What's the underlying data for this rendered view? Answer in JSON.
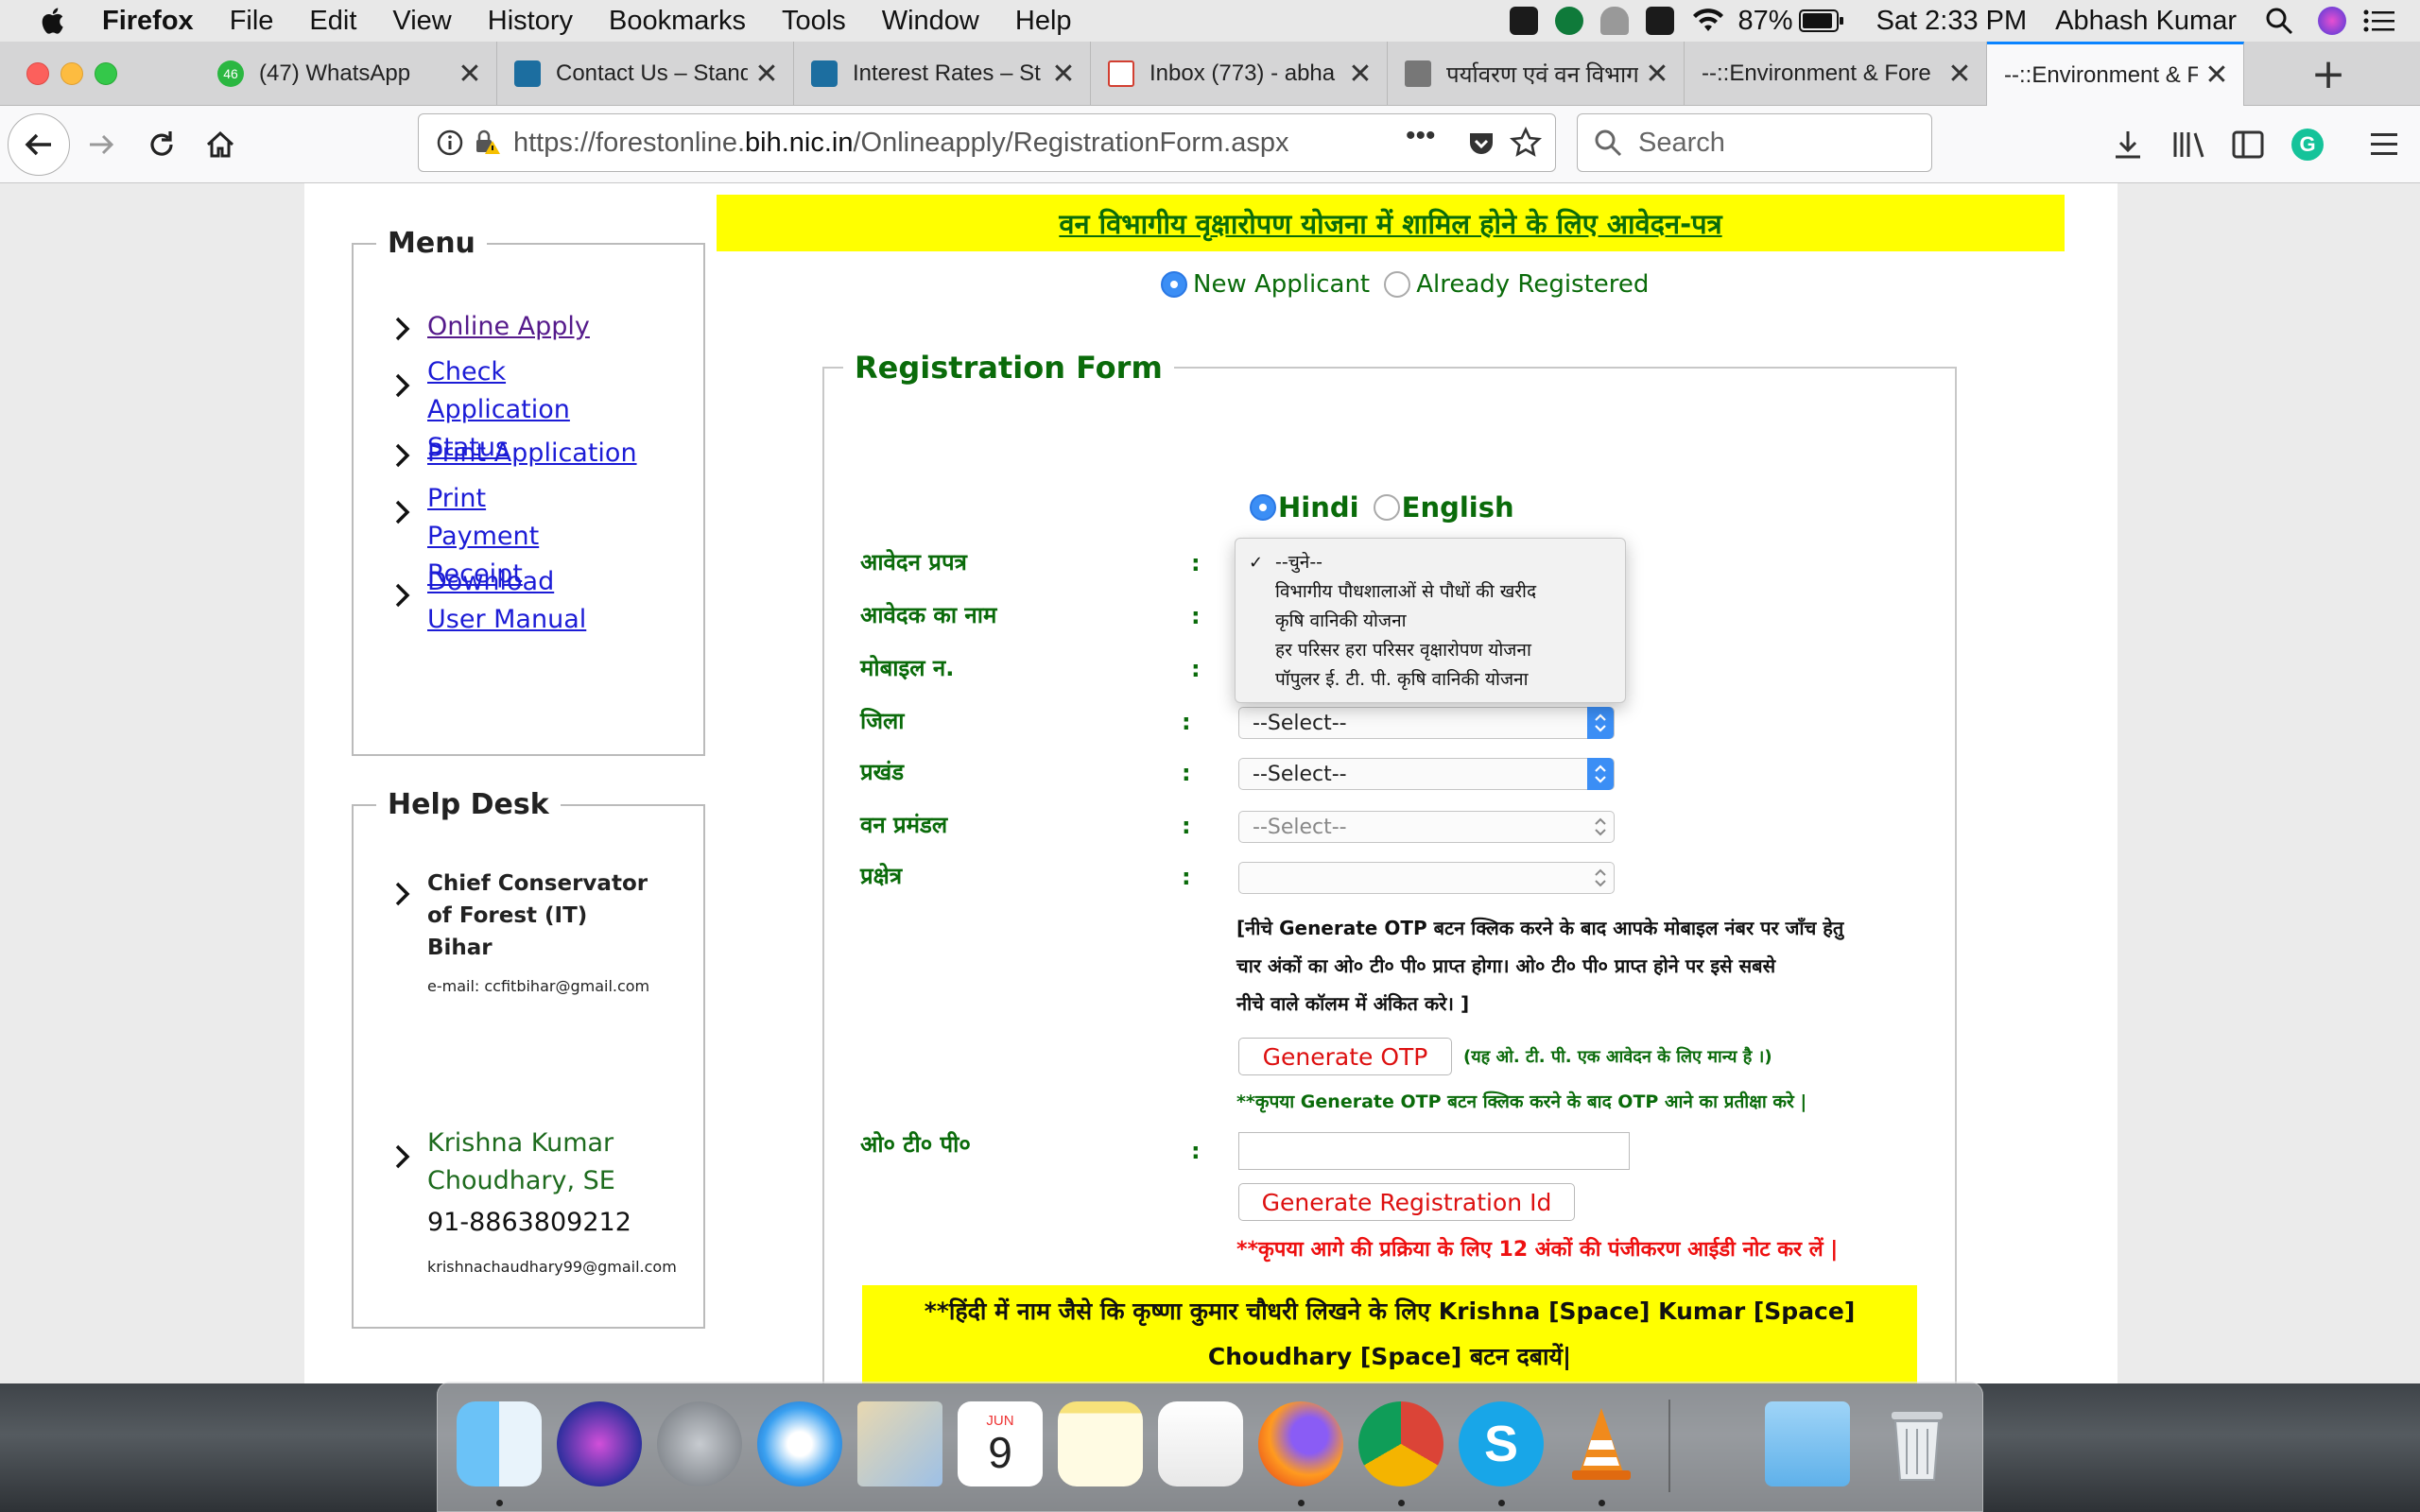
{
  "menubar": {
    "app": "Firefox",
    "items": [
      "File",
      "Edit",
      "View",
      "History",
      "Bookmarks",
      "Tools",
      "Window",
      "Help"
    ],
    "battery": "87%",
    "clock": "Sat 2:33 PM",
    "user": "Abhash Kumar"
  },
  "tabs": [
    {
      "title": "(47) WhatsApp",
      "badge": "46"
    },
    {
      "title": "Contact Us – Stand"
    },
    {
      "title": "Interest Rates – St"
    },
    {
      "title": "Inbox (773) - abha"
    },
    {
      "title": "पर्यावरण एवं वन विभाग"
    },
    {
      "title": "--::Environment & Fore"
    },
    {
      "title": "--::Environment & Fore"
    }
  ],
  "navbar": {
    "url_prefix": "https://forestonline.",
    "url_domain": "bih.nic.in",
    "url_path": "/Onlineapply/RegistrationForm.aspx",
    "search_placeholder": "Search"
  },
  "sidebar": {
    "menu_title": "Menu",
    "menu_items": [
      {
        "label": "Online Apply"
      },
      {
        "label": "Check Application Status"
      },
      {
        "label": "Print Application"
      },
      {
        "label": "Print Payment Receipt"
      },
      {
        "label": "Download User Manual"
      }
    ],
    "helpdesk_title": "Help Desk",
    "contact1_name": "Chief Conservator of Forest (IT) Bihar",
    "contact1_email": "e-mail: ccfitbihar@gmail.com",
    "contact2_name": "Krishna Kumar Choudhary, SE",
    "contact2_phone": "91-8863809212",
    "contact2_email": "krishnachaudhary99@gmail.com"
  },
  "form": {
    "banner": "वन विभागीय वृक्षारोपण योजना में शामिल होने के लिए आवेदन-पत्र",
    "applicant_new": "New Applicant",
    "applicant_registered": "Already Registered",
    "title": "Registration Form",
    "lang_hindi": "Hindi",
    "lang_english": "English",
    "fields": {
      "application_form": "आवेदन प्रपत्र",
      "applicant_name": "आवेदक का नाम",
      "mobile": "मोबाइल न.",
      "district": "जिला",
      "block": "प्रखंड",
      "forest_division": "वन प्रमंडल",
      "range": "प्रक्षेत्र",
      "otp": "ओ० टी० पी०"
    },
    "colon": ":",
    "select_placeholder": "--Select--",
    "dropdown_options": [
      "--चुने--",
      "विभागीय पौधशालाओं से पौधों की खरीद",
      "कृषि वानिकी योजना",
      "हर परिसर हरा परिसर वृक्षारोपण योजना",
      "पॉपुलर ई. टी. पी. कृषि वानिकी योजना"
    ],
    "otp_note_line1": "[नीचे Generate OTP बटन क्लिक करने के बाद आपके मोबाइल नंबर पर जाँच हेतु",
    "otp_note_line2": "चार अंकों का ओ० टी० पी० प्राप्त होगा। ओ० टी० पी० प्राप्त होने पर इसे सबसे",
    "otp_note_line3": "नीचे वाले कॉलम में अंकित करे। ]",
    "generate_otp": "Generate OTP",
    "otp_validity": "(यह ओ. टी. पी. एक आवेदन के लिए मान्य है ।)",
    "otp_wait": "**कृपया Generate OTP बटन क्लिक करने के बाद OTP आने का प्रतीक्षा करे |",
    "generate_reg": "Generate Registration Id",
    "reg_note": "**कृपया आगे की प्रक्रिया के लिए 12 अंकों की पंजीकरण आईडी नोट कर लें |",
    "hint_line1": "**हिंदी में नाम जैसे कि कृष्णा कुमार चौधरी लिखने के लिए Krishna [Space] Kumar [Space]",
    "hint_line2": "Choudhary [Space] बटन दबायें|"
  },
  "dock": {
    "calendar_month": "JUN",
    "calendar_day": "9"
  },
  "colors": {
    "accent_blue": "#0a84ff",
    "form_green": "#0a6b0a",
    "banner_yellow": "#ffff00",
    "button_red": "#dd1010"
  }
}
